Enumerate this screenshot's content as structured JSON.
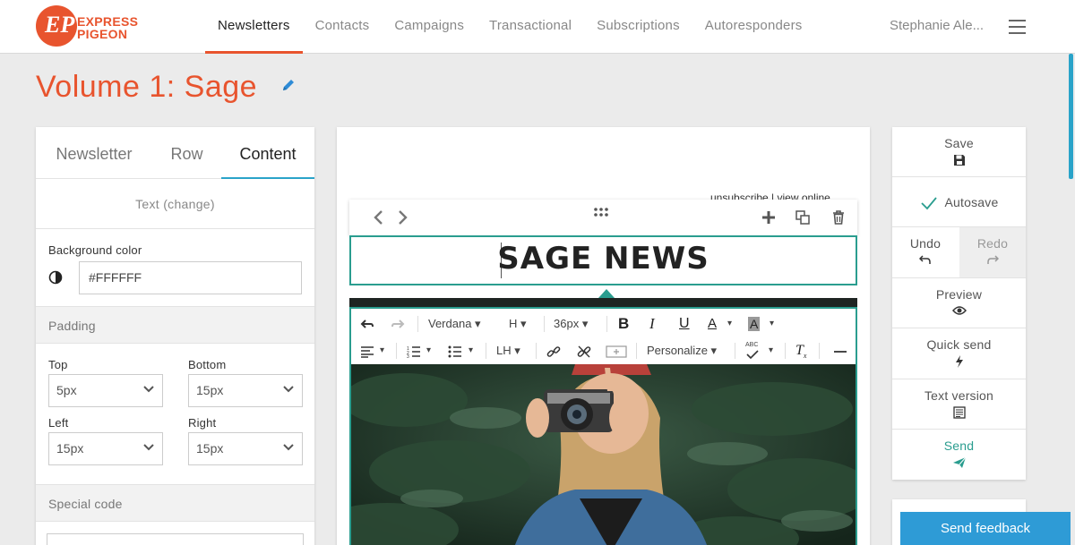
{
  "brand": {
    "logo_line1": "EXPRESS",
    "logo_line2": "PIGEON",
    "accent": "#e8542e"
  },
  "nav": {
    "items": [
      {
        "label": "Newsletters",
        "active": true
      },
      {
        "label": "Contacts"
      },
      {
        "label": "Campaigns"
      },
      {
        "label": "Transactional"
      },
      {
        "label": "Subscriptions"
      },
      {
        "label": "Autoresponders"
      }
    ],
    "user": "Stephanie Ale...",
    "menu_icon": "hamburger-icon"
  },
  "page": {
    "title": "Volume 1: Sage",
    "edit_icon": "pencil-icon"
  },
  "left_panel": {
    "tabs": [
      {
        "label": "Newsletter"
      },
      {
        "label": "Row"
      },
      {
        "label": "Content",
        "active": true
      }
    ],
    "text_change": "Text (change)",
    "background": {
      "label": "Background color",
      "value": "#FFFFFF"
    },
    "padding": {
      "title": "Padding",
      "top": {
        "label": "Top",
        "value": "5px"
      },
      "bottom": {
        "label": "Bottom",
        "value": "15px"
      },
      "left": {
        "label": "Left",
        "value": "15px"
      },
      "right": {
        "label": "Right",
        "value": "15px"
      }
    },
    "special_code": "Special code"
  },
  "canvas": {
    "unsubscribe": "unsubscribe | view online",
    "headline": "SAGE NEWS",
    "editor_toolbar": {
      "font": "Verdana",
      "heading": "H",
      "size": "36px",
      "line_height": "LH",
      "personalize": "Personalize",
      "spellcheck": "ABC"
    }
  },
  "right_panel": {
    "save": "Save",
    "autosave": "Autosave",
    "undo": "Undo",
    "redo": "Redo",
    "preview": "Preview",
    "quick_send": "Quick send",
    "text_version": "Text version",
    "send": "Send"
  },
  "feedback": "Send feedback"
}
